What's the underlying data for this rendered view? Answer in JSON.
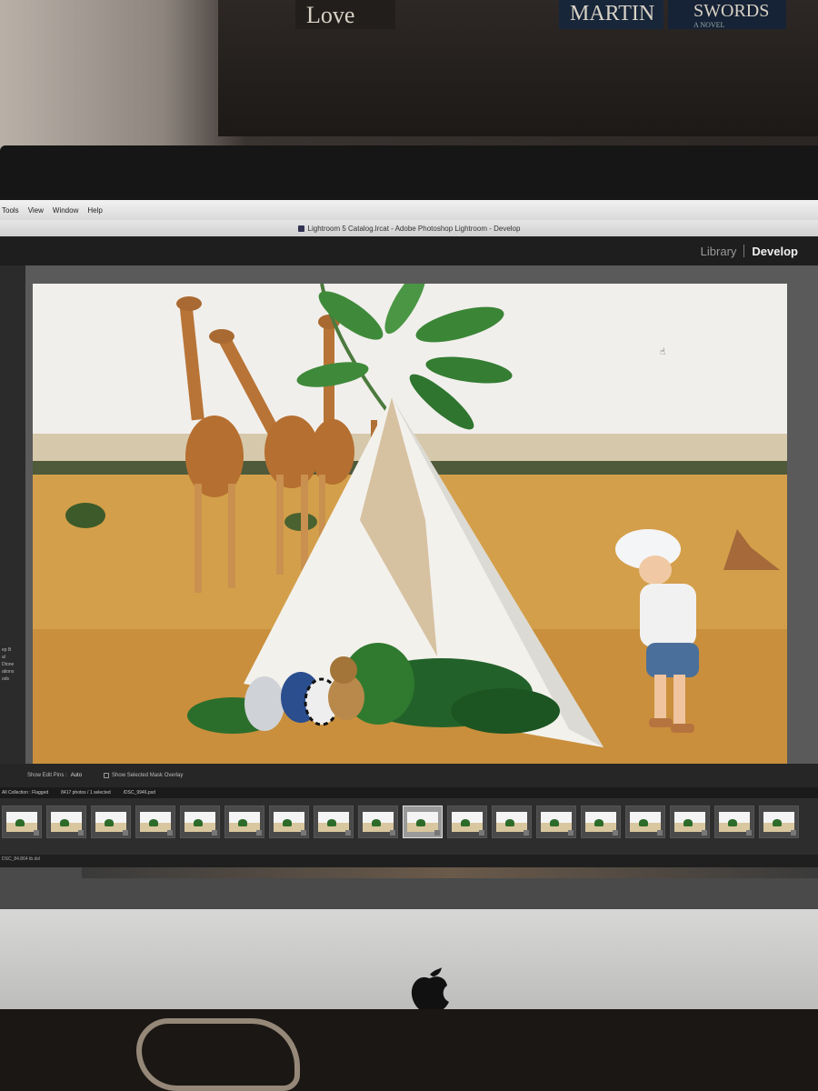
{
  "room": {
    "books": [
      "Love",
      "MARTIN",
      "SWORDS"
    ],
    "book_swords_sub": "A NOVEL"
  },
  "menubar": {
    "items": [
      "Tools",
      "View",
      "Window",
      "Help"
    ]
  },
  "window": {
    "title": "Lightroom 5 Catalog.lrcat - Adobe Photoshop Lightroom - Develop"
  },
  "modules": {
    "library": "Library",
    "develop": "Develop",
    "active": "Develop"
  },
  "toolbar": {
    "edit_pins_label": "Show Edit Pins :",
    "edit_pins_value": "Auto",
    "mask_overlay_label": "Show Selected Mask Overlay"
  },
  "filmbar": {
    "source": "All Collection : Flagged",
    "count": "8417 photos / 1 selected",
    "filename": "/DSC_9946.psd"
  },
  "filmstrip": {
    "thumb_count": 18,
    "selected_index": 9
  },
  "statusline": {
    "text": "DSC_84.864 tb.dsl"
  },
  "left_panel": {
    "labels": [
      "ep B",
      "al",
      "Dtone",
      "ations",
      "ods"
    ]
  },
  "colors": {
    "sky": "#f2f0ee",
    "grass": "#d4a24c",
    "accent_active_module": "#f0f0f0",
    "panel_dark": "#1e1e1e"
  }
}
